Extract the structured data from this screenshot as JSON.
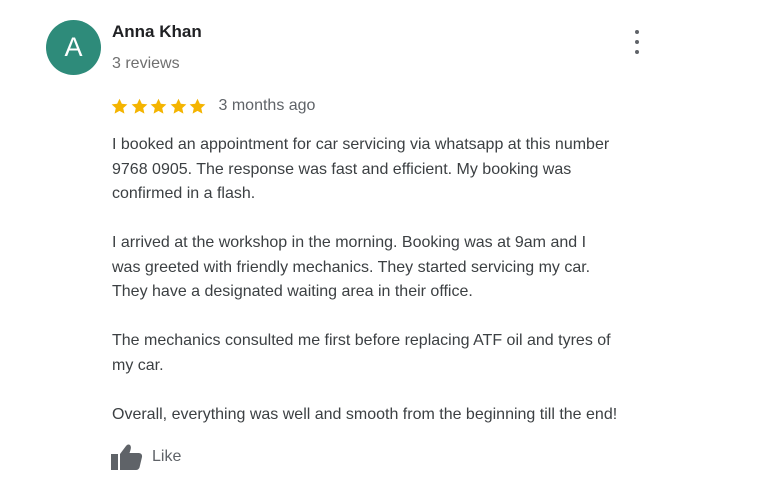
{
  "review": {
    "avatar_letter": "A",
    "reviewer_name": "Anna Khan",
    "review_count": "3 reviews",
    "rating": 5,
    "rating_max": 5,
    "time_ago": "3 months ago",
    "paragraphs": [
      "I booked an appointment for car servicing via whatsapp at this number\n9768 0905. The response was fast and efficient. My booking was\nconfirmed in a flash.",
      "I arrived at the workshop in the morning. Booking was at 9am and I\nwas greeted with friendly mechanics. They started servicing my car.\nThey have a designated waiting area in their office.",
      "The mechanics consulted me first before replacing ATF oil and tyres of\nmy car.",
      "Overall, everything was well and smooth from the beginning till the end!"
    ],
    "like_label": "Like"
  },
  "colors": {
    "avatar_bg": "#2e8b7a",
    "star": "#f4b400"
  },
  "icons": {
    "menu": "more-vert-icon",
    "star": "star-icon",
    "like": "thumbs-up-icon"
  }
}
